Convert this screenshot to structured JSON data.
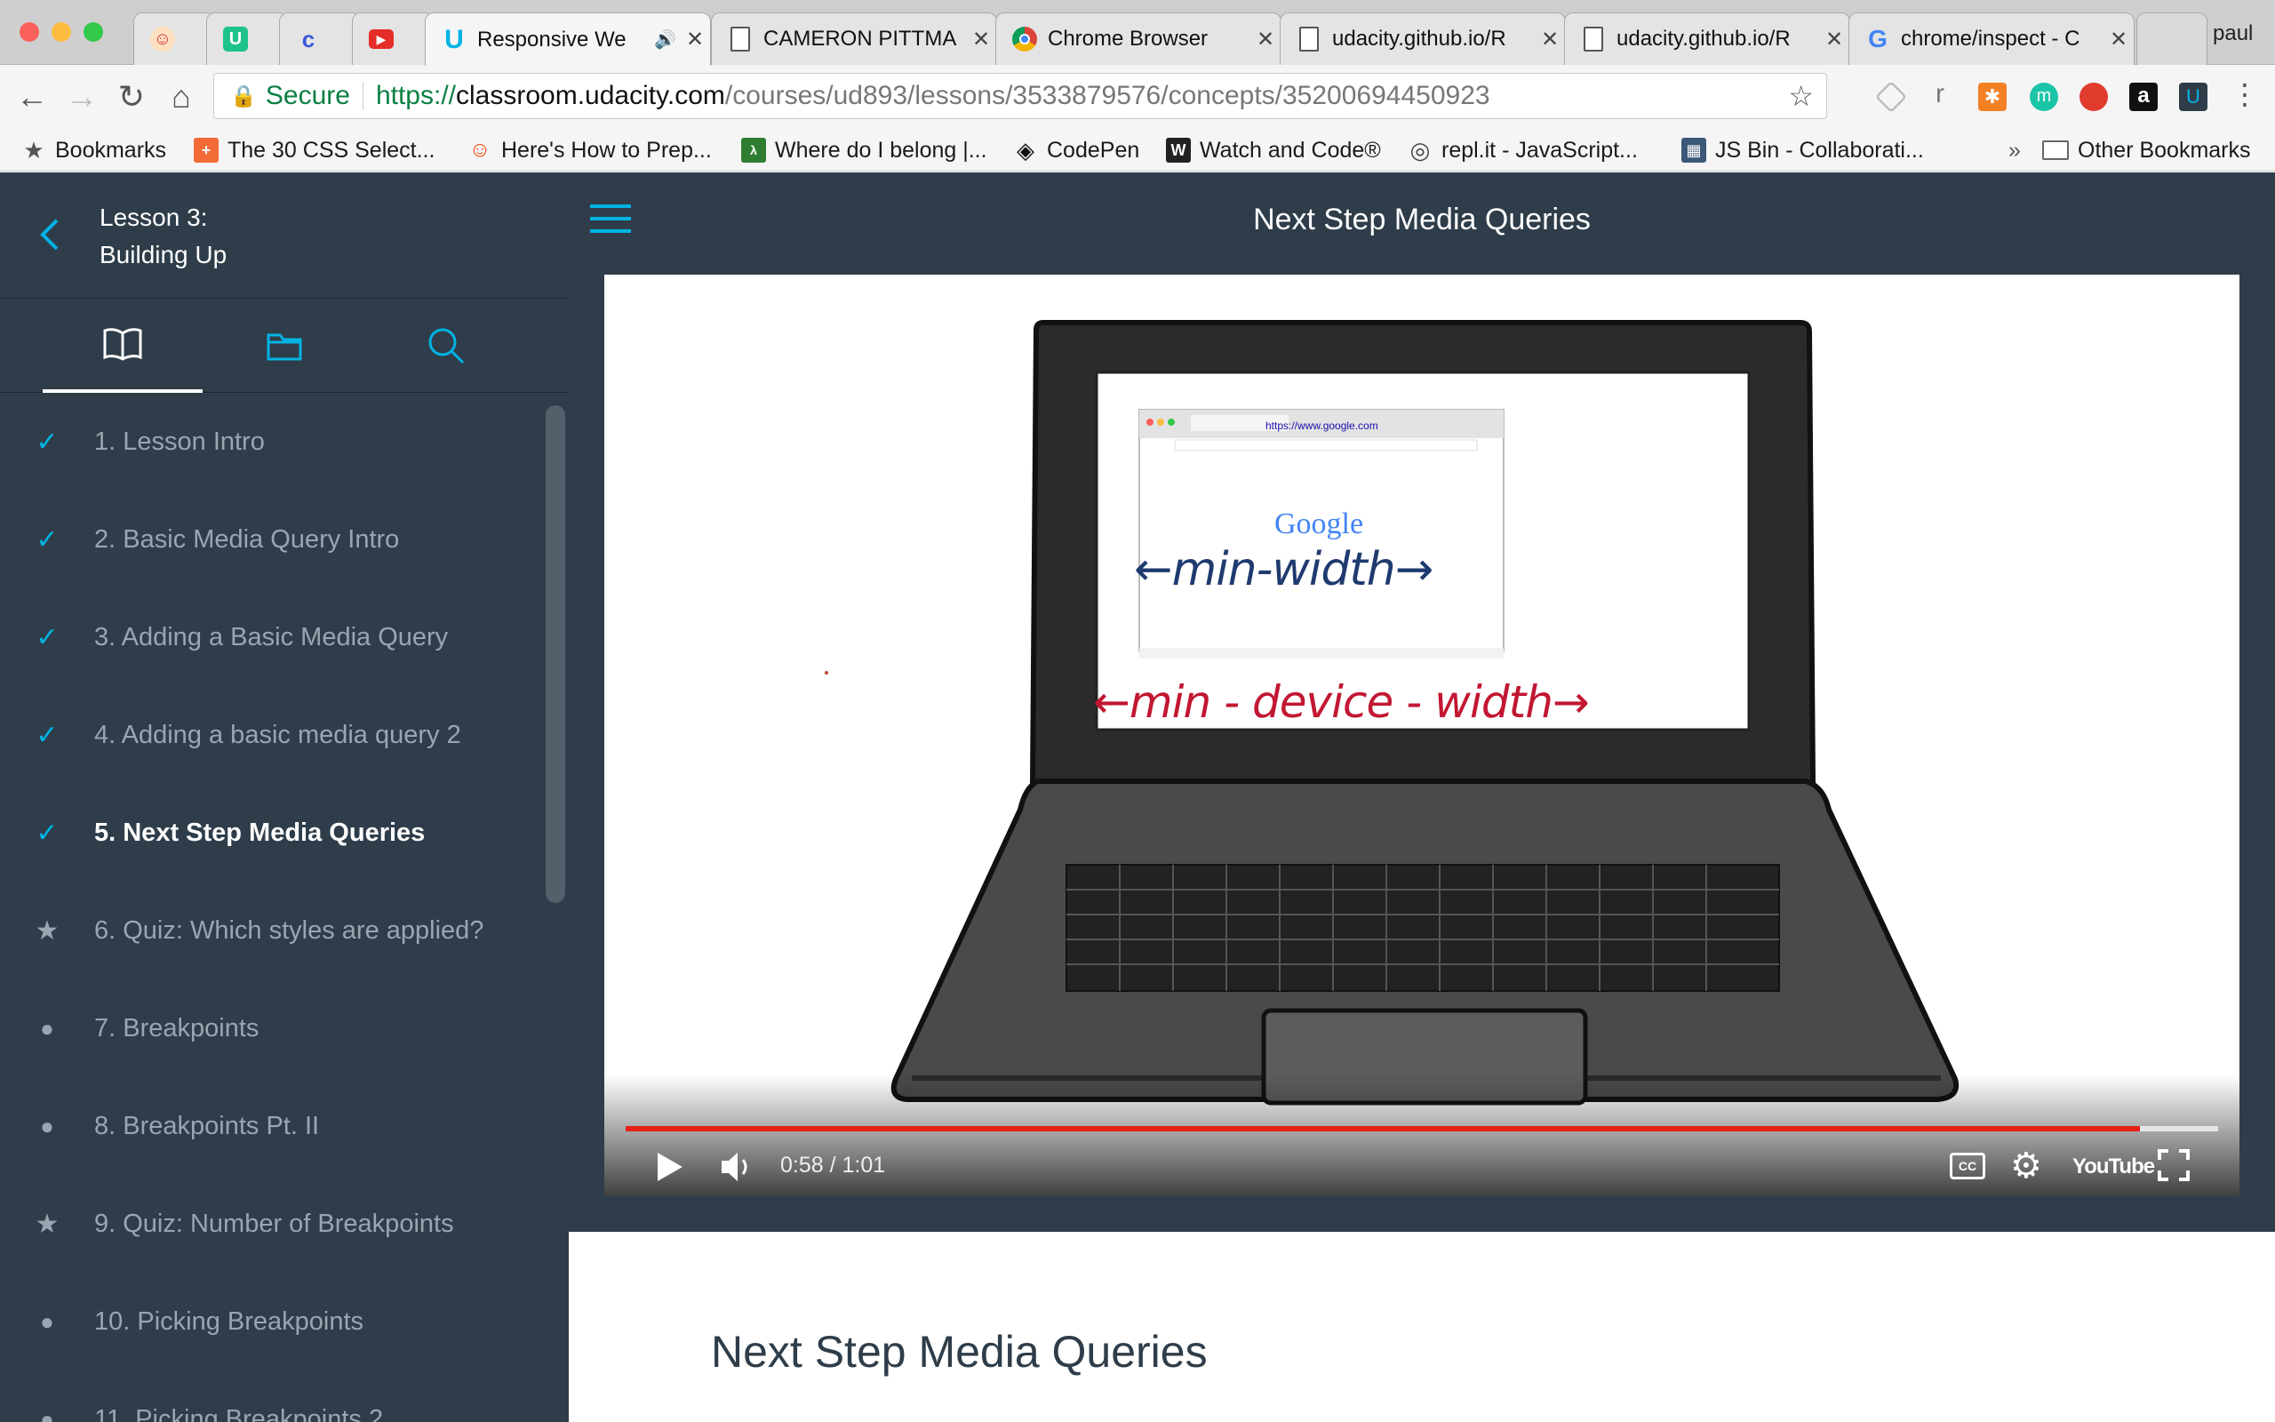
{
  "browser": {
    "profile_name": "paul",
    "tabs": [
      {
        "title": "",
        "icon": "cartoon-favicon-icon"
      },
      {
        "title": "",
        "icon": "udacity-green-favicon-icon"
      },
      {
        "title": "",
        "icon": "c-favicon-icon"
      },
      {
        "title": "",
        "icon": "youtube-favicon-icon"
      },
      {
        "title": "Responsive We",
        "icon": "udacity-favicon-icon",
        "active": true,
        "audio": true
      },
      {
        "title": "CAMERON PITTMA",
        "icon": "document-icon"
      },
      {
        "title": "Chrome Browser",
        "icon": "chrome-icon"
      },
      {
        "title": "udacity.github.io/R",
        "icon": "document-icon"
      },
      {
        "title": "udacity.github.io/R",
        "icon": "document-icon"
      },
      {
        "title": "chrome/inspect - C",
        "icon": "google-g-icon"
      }
    ],
    "address": {
      "secure_label": "Secure",
      "scheme": "https://",
      "host": "classroom.udacity.com",
      "path": "/courses/ud893/lessons/3533879576/concepts/35200694450923"
    },
    "bookmarks": [
      {
        "label": "Bookmarks"
      },
      {
        "label": "The 30 CSS Select..."
      },
      {
        "label": "Here's How to Prep..."
      },
      {
        "label": "Where do I belong |..."
      },
      {
        "label": "CodePen"
      },
      {
        "label": "Watch and Code®"
      },
      {
        "label": "repl.it - JavaScript..."
      },
      {
        "label": "JS Bin - Collaborati..."
      }
    ],
    "bookmarks_overflow": "»",
    "other_bookmarks": "Other Bookmarks",
    "extension_r": "r"
  },
  "sidebar": {
    "lesson_line1": "Lesson 3:",
    "lesson_line2": "Building Up",
    "items": [
      {
        "label": "1. Lesson Intro",
        "status": "done"
      },
      {
        "label": "2. Basic Media Query Intro",
        "status": "done"
      },
      {
        "label": "3. Adding a Basic Media Query",
        "status": "done"
      },
      {
        "label": "4. Adding a basic media query 2",
        "status": "done"
      },
      {
        "label": "5. Next Step Media Queries",
        "status": "current"
      },
      {
        "label": "6. Quiz: Which styles are applied?",
        "status": "quiz"
      },
      {
        "label": "7. Breakpoints",
        "status": "todo"
      },
      {
        "label": "8. Breakpoints Pt. II",
        "status": "todo"
      },
      {
        "label": "9. Quiz: Number of Breakpoints",
        "status": "quiz"
      },
      {
        "label": "10. Picking Breakpoints",
        "status": "todo"
      },
      {
        "label": "11. Picking Breakpoints 2",
        "status": "todo"
      }
    ]
  },
  "main": {
    "topbar_title": "Next Step Media Queries",
    "content_heading": "Next Step Media Queries"
  },
  "video": {
    "time": "0:58 / 1:01",
    "progress": 0.951,
    "buffered": 1.0,
    "annotation_blue": "←min-width→",
    "annotation_red": "←min - device - width→",
    "screen_logo": "Google",
    "screen_url": "https://www.google.com",
    "cc_label": "CC",
    "youtube_label": "YouTube"
  },
  "colors": {
    "sidebar_bg": "#2e3d49",
    "accent": "#02b3e4",
    "progress_red": "#e62117",
    "secure_green": "#0b8043"
  }
}
